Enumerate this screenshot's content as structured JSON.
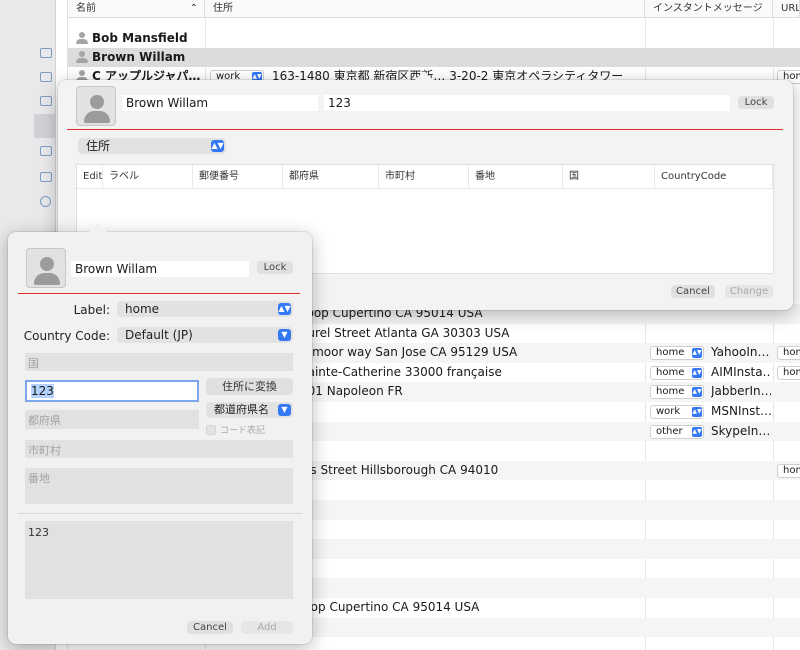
{
  "table": {
    "headers": [
      "名前",
      "住所",
      "インスタントメッセージ",
      "URL"
    ],
    "rows": [
      {
        "name": "",
        "address": "",
        "im_label": "",
        "im_value": "",
        "url_label": ""
      },
      {
        "name": "Bob Mansfield",
        "address": "",
        "im_label": "",
        "im_value": "",
        "url_label": ""
      },
      {
        "name": "Brown Willam",
        "address": "",
        "im_label": "",
        "im_value": "",
        "url_label": "",
        "selected": true
      },
      {
        "name": "C アップルジャパ…",
        "address_label": "work",
        "address": "163-1480 東京都 新宿区西新… 3-20-2 東京オペラシティタワー",
        "im_label": "",
        "im_value": "",
        "url_label": "hom"
      }
    ],
    "lower_rows": [
      {
        "address": "Loop Cupertino CA 95014 USA",
        "im_label": "",
        "im_value": "",
        "url_label": ""
      },
      {
        "address": "aurel Street Atlanta GA 30303 USA",
        "im_label": "",
        "im_value": "",
        "url_label": ""
      },
      {
        "address": "etmoor way San Jose CA 95129 USA",
        "im_label": "home",
        "im_value": "YahooIn…",
        "url_label": "hom"
      },
      {
        "address": "Sainte-Catherine 33000  française",
        "im_label": "home",
        "im_value": "AIMInsta…",
        "url_label": "hom"
      },
      {
        "address": "001 Napoleon FR",
        "im_label": "home",
        "im_value": "JabberIn…",
        "url_label": ""
      },
      {
        "address": "",
        "im_label": "work",
        "im_value": "MSNInst…",
        "url_label": ""
      },
      {
        "address": "",
        "im_label": "other",
        "im_value": "SkypeIn…",
        "url_label": ""
      },
      {
        "address": "",
        "im_label": "",
        "im_value": "",
        "url_label": ""
      },
      {
        "address": "vis Street Hillsborough CA 94010",
        "im_label": "",
        "im_value": "",
        "url_label": "hom"
      },
      {
        "address": "",
        "im_label": "",
        "im_value": "",
        "url_label": ""
      },
      {
        "address": "",
        "im_label": "",
        "im_value": "",
        "url_label": ""
      },
      {
        "address": "",
        "im_label": "",
        "im_value": "",
        "url_label": ""
      },
      {
        "address": "",
        "im_label": "",
        "im_value": "",
        "url_label": ""
      },
      {
        "address": "",
        "im_label": "",
        "im_value": "",
        "url_label": ""
      },
      {
        "address": "",
        "im_label": "",
        "im_value": "",
        "url_label": ""
      },
      {
        "address": "loop Cupertino CA 95014 USA",
        "im_label": "",
        "im_value": "",
        "url_label": ""
      },
      {
        "address": "",
        "im_label": "",
        "im_value": "",
        "url_label": ""
      }
    ]
  },
  "top_popover": {
    "name_value": "Brown Willam",
    "field_value": "123",
    "lock_label": "Lock",
    "section_popup": "住所",
    "grid_headers": [
      "Edit",
      "ラベル",
      "郵便番号",
      "都府県",
      "市町村",
      "番地",
      "国",
      "CountryCode"
    ],
    "cancel_label": "Cancel",
    "change_label": "Change"
  },
  "left_popover": {
    "name_value": "Brown Willam",
    "lock_label": "Lock",
    "label_caption": "Label:",
    "label_value": "home",
    "country_code_caption": "Country Code:",
    "country_code_value": "Default (JP)",
    "country_placeholder": "国",
    "postal_value": "123",
    "convert_button": "住所に変換",
    "prefecture_placeholder": "都府県",
    "prefecture_popup": "都道府県名",
    "code_checkbox_label": "コード表記",
    "city_placeholder": "市町村",
    "street_placeholder": "番地",
    "preview_text": "123",
    "cancel_label": "Cancel",
    "add_label": "Add"
  },
  "colors": {
    "accent": "#3478f6",
    "red_line": "#d93025",
    "focus_ring": "#7aa7ee"
  }
}
